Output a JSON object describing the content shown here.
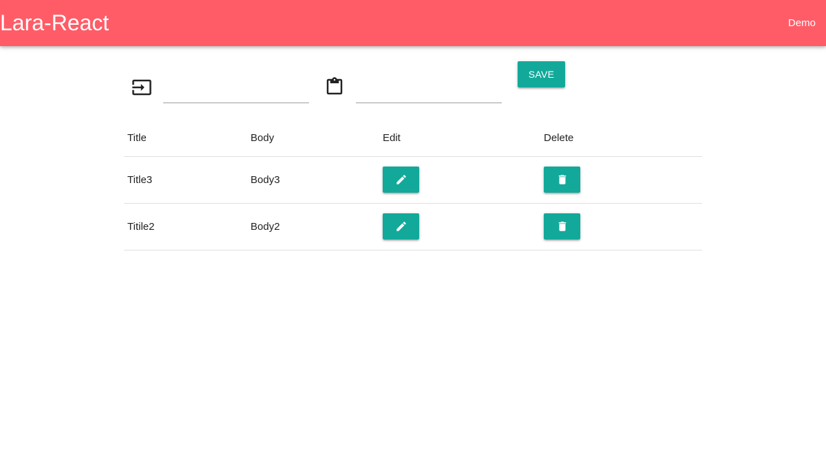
{
  "navbar": {
    "brand": "Lara-React",
    "link": "Demo",
    "color": "#ff5c67"
  },
  "form": {
    "title_icon": "input-icon",
    "title_value": "",
    "body_icon": "clipboard-icon",
    "body_value": "",
    "save_label": "SAVE"
  },
  "table": {
    "headers": [
      "Title",
      "Body",
      "Edit",
      "Delete"
    ],
    "rows": [
      {
        "title": "Title3",
        "body": "Body3"
      },
      {
        "title": "Titile2",
        "body": "Body2"
      }
    ],
    "edit_icon": "pencil-icon",
    "delete_icon": "trash-icon"
  },
  "accent_color": "#12a99a"
}
